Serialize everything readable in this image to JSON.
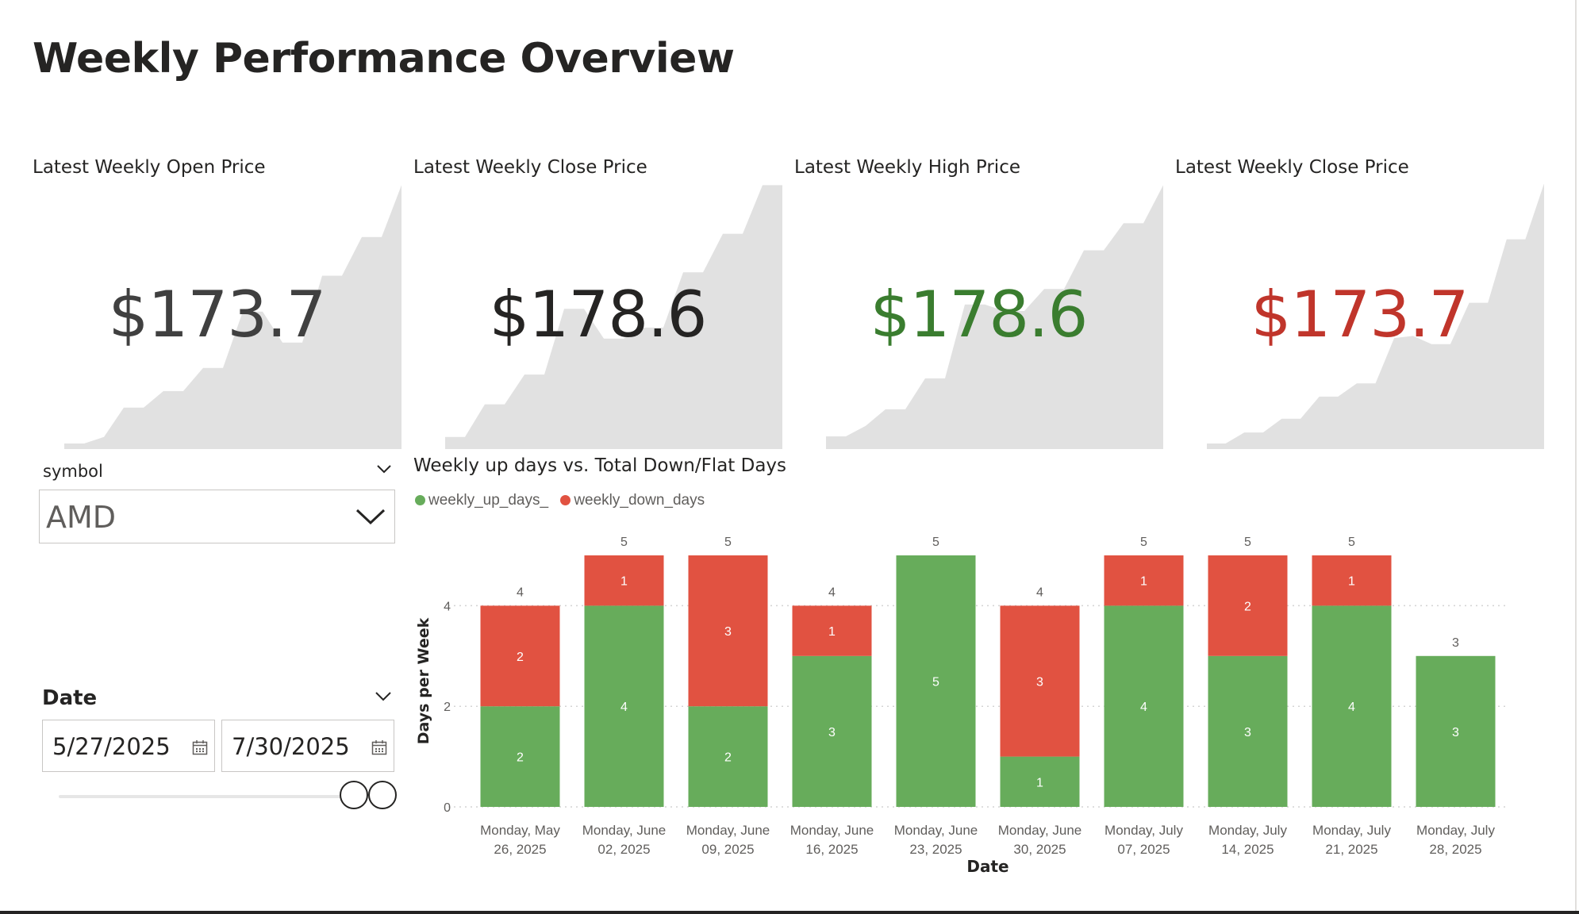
{
  "page": {
    "title": "Weekly Performance Overview"
  },
  "cards": [
    {
      "title": "Latest Weekly Open Price",
      "value": "$173.7",
      "value_color": "#404040",
      "spark": [
        151.0,
        151.0,
        152.2,
        157.5,
        157.5,
        160.5,
        160.5,
        164.7,
        164.7,
        174.9,
        174.9,
        169.3,
        169.3,
        181.4,
        181.4,
        188.4,
        188.4,
        197.8
      ]
    },
    {
      "title": "Latest Weekly Close Price",
      "value": "$178.6",
      "value_color": "#252423",
      "spark": [
        152.2,
        152.2,
        158.1,
        158.1,
        163.5,
        163.5,
        175.4,
        175.4,
        170.0,
        170.0,
        172.0,
        172.0,
        182.0,
        182.0,
        189.0,
        189.0,
        197.8,
        197.8
      ]
    },
    {
      "title": "Latest Weekly High Price",
      "value": "$178.6",
      "value_color": "#3a7d2f",
      "spark": [
        152.3,
        152.3,
        154.2,
        157.2,
        157.2,
        162.8,
        162.8,
        176.2,
        176.2,
        175.0,
        175.0,
        179.0,
        179.0,
        186.0,
        186.0,
        190.9,
        190.9,
        197.8
      ]
    },
    {
      "title": "Latest Weekly Close Price",
      "value": "$173.7",
      "value_color": "#c0352b",
      "spark": [
        151.0,
        151.0,
        153.0,
        153.0,
        155.5,
        155.5,
        159.5,
        159.5,
        161.9,
        161.9,
        170.1,
        170.5,
        169.0,
        169.0,
        176.5,
        176.5,
        188.0,
        188.0,
        198.1
      ]
    }
  ],
  "filters": {
    "symbol": {
      "label": "symbol",
      "value": "AMD"
    },
    "date": {
      "label": "Date",
      "start": "5/27/2025",
      "end": "7/30/2025"
    }
  },
  "colors": {
    "up": "#67ac5b",
    "down": "#e15241",
    "spark": "#e1e1e1"
  },
  "chart_data": {
    "type": "bar",
    "stacked": true,
    "title": "Weekly up days vs. Total Down/Flat Days",
    "xlabel": "Date",
    "ylabel": "Days per Week",
    "ylim": [
      0,
      5
    ],
    "yticks": [
      0,
      2,
      4
    ],
    "grid": true,
    "legend": "top-left",
    "categories": [
      [
        "Monday, May",
        "26, 2025"
      ],
      [
        "Monday, June",
        "02, 2025"
      ],
      [
        "Monday, June",
        "09, 2025"
      ],
      [
        "Monday, June",
        "16, 2025"
      ],
      [
        "Monday, June",
        "23, 2025"
      ],
      [
        "Monday, June",
        "30, 2025"
      ],
      [
        "Monday, July",
        "07, 2025"
      ],
      [
        "Monday, July",
        "14, 2025"
      ],
      [
        "Monday, July",
        "21, 2025"
      ],
      [
        "Monday, July",
        "28, 2025"
      ]
    ],
    "series": [
      {
        "name": "weekly_up_days_",
        "values": [
          2,
          4,
          2,
          3,
          5,
          1,
          4,
          3,
          4,
          3
        ]
      },
      {
        "name": "weekly_down_days",
        "values": [
          2,
          1,
          3,
          1,
          0,
          3,
          1,
          2,
          1,
          0
        ]
      }
    ],
    "totals": [
      4,
      5,
      5,
      4,
      5,
      4,
      5,
      5,
      5,
      3
    ]
  }
}
